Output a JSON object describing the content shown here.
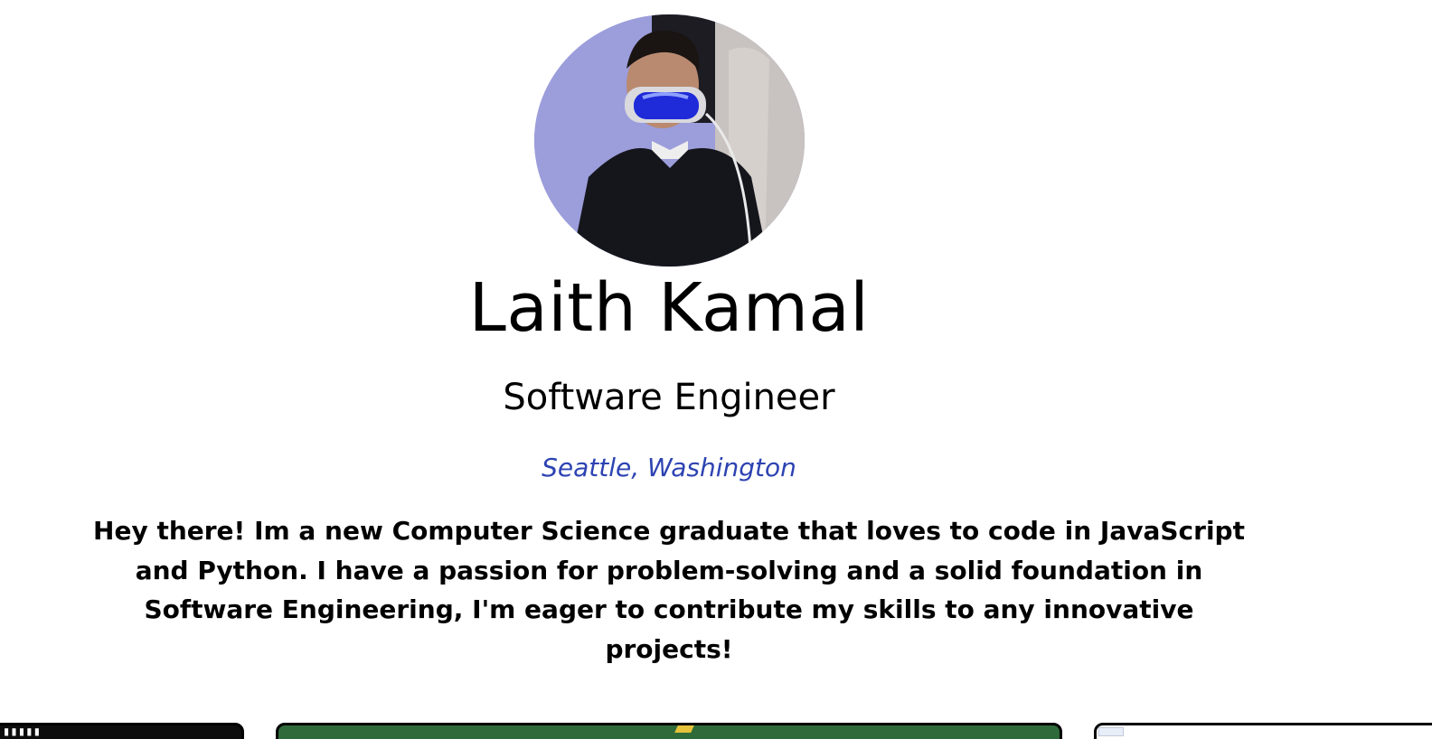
{
  "profile": {
    "name": "Laith Kamal",
    "role": "Software Engineer",
    "location": "Seattle, Washington",
    "bio": "Hey there! Im a new Computer Science graduate that loves to code in JavaScript and Python. I have a passion for problem-solving and a solid foundation in Software Engineering, I'm eager to contribute my skills to any innovative projects!",
    "avatar_icon": "profile-photo",
    "location_color": "#2d43b2"
  },
  "project_cards": [
    {
      "thumbnail": "dark-project-thumbnail"
    },
    {
      "thumbnail": "green-project-thumbnail"
    },
    {
      "thumbnail": "light-project-thumbnail"
    }
  ]
}
